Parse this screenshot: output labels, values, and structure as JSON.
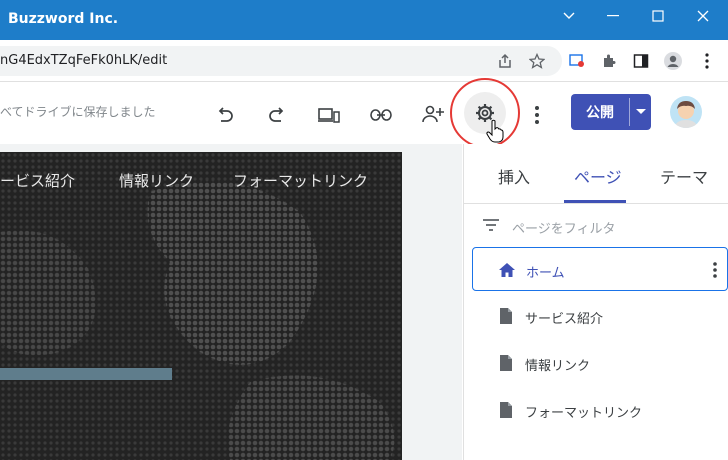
{
  "window": {
    "title": "Buzzword Inc."
  },
  "browser": {
    "url": "nG4EdxTZqFeFk0hLK/edit"
  },
  "toolbar": {
    "save_status": "べてドライブに保存しました",
    "publish_label": "公開",
    "tooltip": "設定"
  },
  "preview": {
    "nav": [
      "ービス紹介",
      "情報リンク",
      "フォーマットリンク"
    ]
  },
  "panel": {
    "tabs": [
      "挿入",
      "ページ",
      "テーマ"
    ],
    "active_tab": "ページ",
    "filter_placeholder": "ページをフィルタ",
    "pages": [
      "ホーム",
      "サービス紹介",
      "情報リンク",
      "フォーマットリンク"
    ],
    "selected_page": "ホーム"
  },
  "colors": {
    "titlebar": "#1e7dc9",
    "accent": "#3f51b5",
    "highlight_circle": "#e53935"
  },
  "icons": {
    "undo": "undo-icon",
    "redo": "redo-icon",
    "preview": "devices-preview-icon",
    "link": "link-icon",
    "share": "add-person-icon",
    "settings": "gear-icon",
    "more": "more-vert-icon"
  }
}
